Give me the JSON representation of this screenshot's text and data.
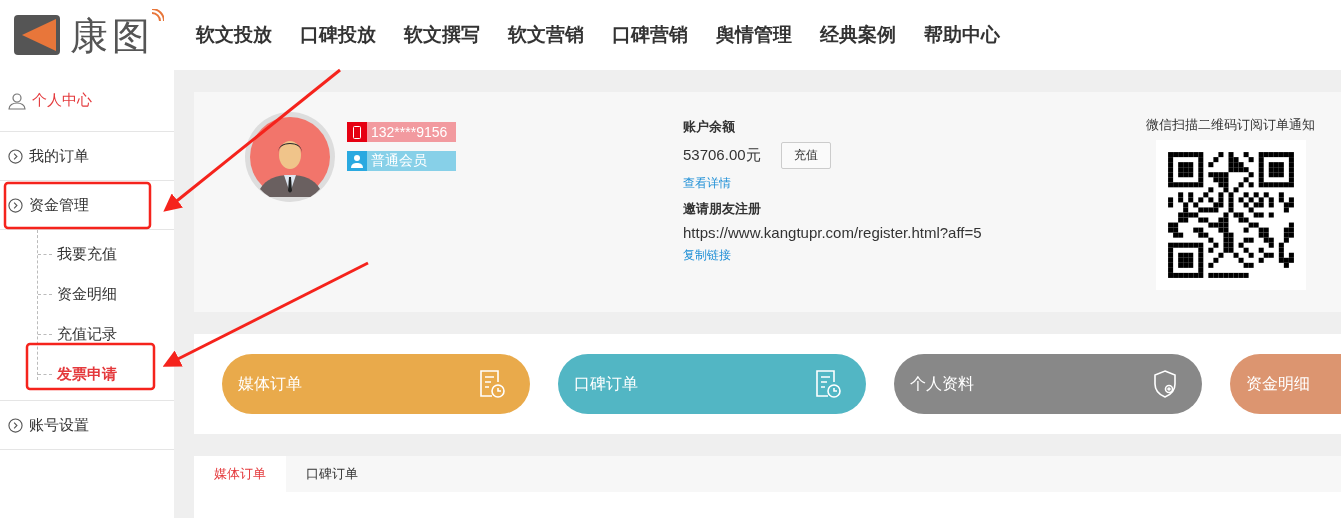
{
  "logo": {
    "text": "康图"
  },
  "nav": [
    {
      "label": "软文投放"
    },
    {
      "label": "口碑投放"
    },
    {
      "label": "软文撰写"
    },
    {
      "label": "软文营销"
    },
    {
      "label": "口碑营销"
    },
    {
      "label": "舆情管理"
    },
    {
      "label": "经典案例"
    },
    {
      "label": "帮助中心"
    }
  ],
  "sidebar": {
    "title": {
      "label": "个人中心",
      "selected": true
    },
    "items": [
      {
        "label": "我的订单"
      },
      {
        "label": "资金管理",
        "children": [
          {
            "label": "我要充值",
            "selected": false
          },
          {
            "label": "资金明细",
            "selected": false
          },
          {
            "label": "充值记录",
            "selected": false
          },
          {
            "label": "发票申请",
            "selected": true
          }
        ]
      },
      {
        "label": "账号设置"
      }
    ]
  },
  "profile": {
    "phone": "132****9156",
    "member_level": "普通会员",
    "balance_label": "账户余额",
    "balance": "53706.00元",
    "recharge_button": "充值",
    "details_link": "查看详情",
    "invite_label": "邀请朋友注册",
    "invite_url": "https://www.kangtupr.com/register.html?aff=5",
    "copy_link": "复制链接",
    "qr_caption": "微信扫描二维码订阅订单通知"
  },
  "quick_links": [
    {
      "label": "媒体订单",
      "color": "#e9aa4b",
      "kind": "orders"
    },
    {
      "label": "口碑订单",
      "color": "#52b6c4",
      "kind": "orders"
    },
    {
      "label": "个人资料",
      "color": "#888888",
      "kind": "profile"
    },
    {
      "label": "资金明细",
      "color": "#dc9570",
      "kind": "funds"
    }
  ],
  "order_tabs": [
    {
      "label": "媒体订单",
      "selected": true
    },
    {
      "label": "口碑订单",
      "selected": false
    }
  ]
}
